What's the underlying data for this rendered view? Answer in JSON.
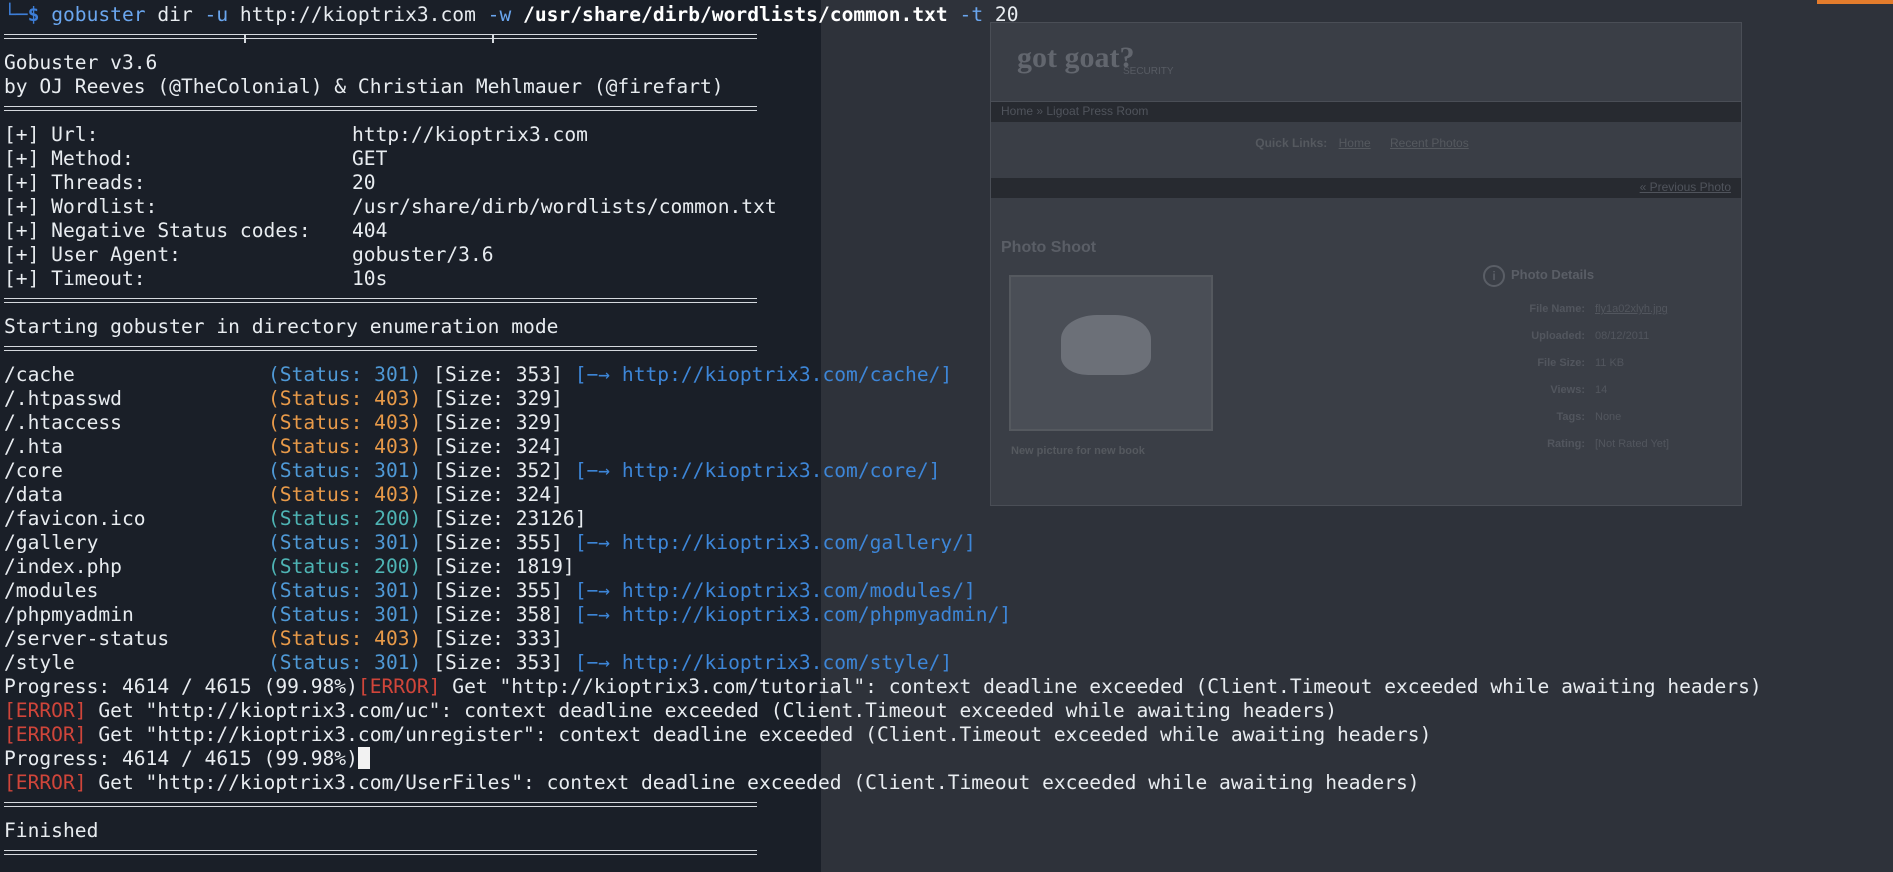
{
  "colors": {
    "terminal_bg": "#1b2029",
    "text": "#e8ecf0",
    "prompt": "#3d7ed8",
    "status_301": "#4f99d6",
    "status_403": "#e89a49",
    "status_200": "#4eb4b4",
    "error": "#d0453a",
    "accent": "#e47c2c"
  },
  "prompt": {
    "corner": "└─",
    "symbol": "$",
    "command": "gobuster",
    "subcommand": " dir ",
    "flag_u": "-u",
    "url_arg": " http://kioptrix3.com ",
    "flag_w": "-w",
    "wordlist_arg": " /usr/share/dirb/wordlists/common.txt",
    "flag_t": " -t",
    "threads_arg": " 20"
  },
  "banner": {
    "version": "Gobuster v3.6",
    "authors": "by OJ Reeves (@TheColonial) & Christian Mehlmauer (@firefart)"
  },
  "config": [
    {
      "label": "[+] Url:",
      "value": "http://kioptrix3.com"
    },
    {
      "label": "[+] Method:",
      "value": "GET"
    },
    {
      "label": "[+] Threads:",
      "value": "20"
    },
    {
      "label": "[+] Wordlist:",
      "value": "/usr/share/dirb/wordlists/common.txt"
    },
    {
      "label": "[+] Negative Status codes:",
      "value": "404"
    },
    {
      "label": "[+] User Agent:",
      "value": "gobuster/3.6"
    },
    {
      "label": "[+] Timeout:",
      "value": "10s"
    }
  ],
  "mode_message": "Starting gobuster in directory enumeration mode",
  "results": [
    {
      "path": "/cache",
      "status": "(Status: 301)",
      "code": 301,
      "size": "[Size: 353]",
      "redirect": "[−→ http://kioptrix3.com/cache/]"
    },
    {
      "path": "/.htpasswd",
      "status": "(Status: 403)",
      "code": 403,
      "size": "[Size: 329]",
      "redirect": ""
    },
    {
      "path": "/.htaccess",
      "status": "(Status: 403)",
      "code": 403,
      "size": "[Size: 329]",
      "redirect": ""
    },
    {
      "path": "/.hta",
      "status": "(Status: 403)",
      "code": 403,
      "size": "[Size: 324]",
      "redirect": ""
    },
    {
      "path": "/core",
      "status": "(Status: 301)",
      "code": 301,
      "size": "[Size: 352]",
      "redirect": "[−→ http://kioptrix3.com/core/]"
    },
    {
      "path": "/data",
      "status": "(Status: 403)",
      "code": 403,
      "size": "[Size: 324]",
      "redirect": ""
    },
    {
      "path": "/favicon.ico",
      "status": "(Status: 200)",
      "code": 200,
      "size": "[Size: 23126]",
      "redirect": ""
    },
    {
      "path": "/gallery",
      "status": "(Status: 301)",
      "code": 301,
      "size": "[Size: 355]",
      "redirect": "[−→ http://kioptrix3.com/gallery/]"
    },
    {
      "path": "/index.php",
      "status": "(Status: 200)",
      "code": 200,
      "size": "[Size: 1819]",
      "redirect": ""
    },
    {
      "path": "/modules",
      "status": "(Status: 301)",
      "code": 301,
      "size": "[Size: 355]",
      "redirect": "[−→ http://kioptrix3.com/modules/]"
    },
    {
      "path": "/phpmyadmin",
      "status": "(Status: 301)",
      "code": 301,
      "size": "[Size: 358]",
      "redirect": "[−→ http://kioptrix3.com/phpmyadmin/]"
    },
    {
      "path": "/server-status",
      "status": "(Status: 403)",
      "code": 403,
      "size": "[Size: 333]",
      "redirect": ""
    },
    {
      "path": "/style",
      "status": "(Status: 301)",
      "code": 301,
      "size": "[Size: 353]",
      "redirect": "[−→ http://kioptrix3.com/style/]"
    }
  ],
  "progress_1": "Progress: 4614 / 4615 (99.98%)",
  "error_tag": "[ERROR]",
  "error_1": " Get \"http://kioptrix3.com/tutorial\": context deadline exceeded (Client.Timeout exceeded while awaiting headers)",
  "error_2": " Get \"http://kioptrix3.com/uc\": context deadline exceeded (Client.Timeout exceeded while awaiting headers)",
  "error_3": " Get \"http://kioptrix3.com/unregister\": context deadline exceeded (Client.Timeout exceeded while awaiting headers)",
  "progress_2": "Progress: 4614 / 4615 (99.98%)",
  "error_4": " Get \"http://kioptrix3.com/UserFiles\": context deadline exceeded (Client.Timeout exceeded while awaiting headers)",
  "finished": "Finished",
  "background_page": {
    "logo": "got goat?",
    "tagline": "SECURITY",
    "breadcrumb": "Home » Ligoat Press Room",
    "quick_links_label": "Quick Links:",
    "quick_link_home": "Home",
    "quick_link_recent": "Recent Photos",
    "previous_photo": "« Previous Photo",
    "photo_title": "Photo Shoot",
    "photo_caption": "New picture for new book",
    "details_title": "Photo Details",
    "details": [
      {
        "label": "File Name:",
        "value": "fly1a02xlyh.jpg"
      },
      {
        "label": "Uploaded:",
        "value": "08/12/2011"
      },
      {
        "label": "File Size:",
        "value": "11 KB"
      },
      {
        "label": "Views:",
        "value": "14"
      },
      {
        "label": "Tags:",
        "value": "None"
      },
      {
        "label": "Rating:",
        "value": "[Not Rated Yet]"
      }
    ]
  }
}
